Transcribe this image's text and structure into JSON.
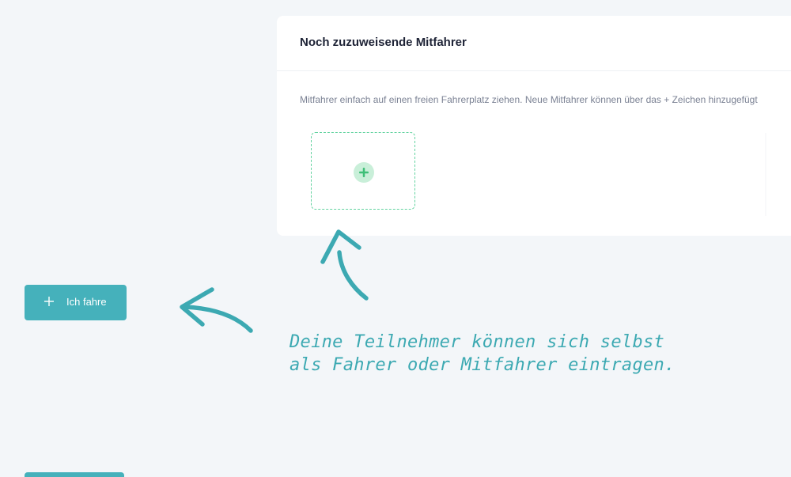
{
  "panel": {
    "title": "Noch zuzuweisende Mitfahrer",
    "hint": "Mitfahrer einfach auf einen freien Fahrerplatz ziehen. Neue Mitfahrer können über das + Zeichen hinzugefügt",
    "add_slot_icon": "plus-circle-icon"
  },
  "actions": {
    "drive_label": "Ich fahre",
    "drive_icon": "plus-icon"
  },
  "annotation": {
    "line1": "Deine Teilnehmer können sich selbst",
    "line2": "als Fahrer oder Mitfahrer eintragen."
  },
  "colors": {
    "accent": "#45b1bb",
    "slot_border": "#63d3a0",
    "annotation": "#3ca9b2",
    "background": "#f3f6f9"
  }
}
